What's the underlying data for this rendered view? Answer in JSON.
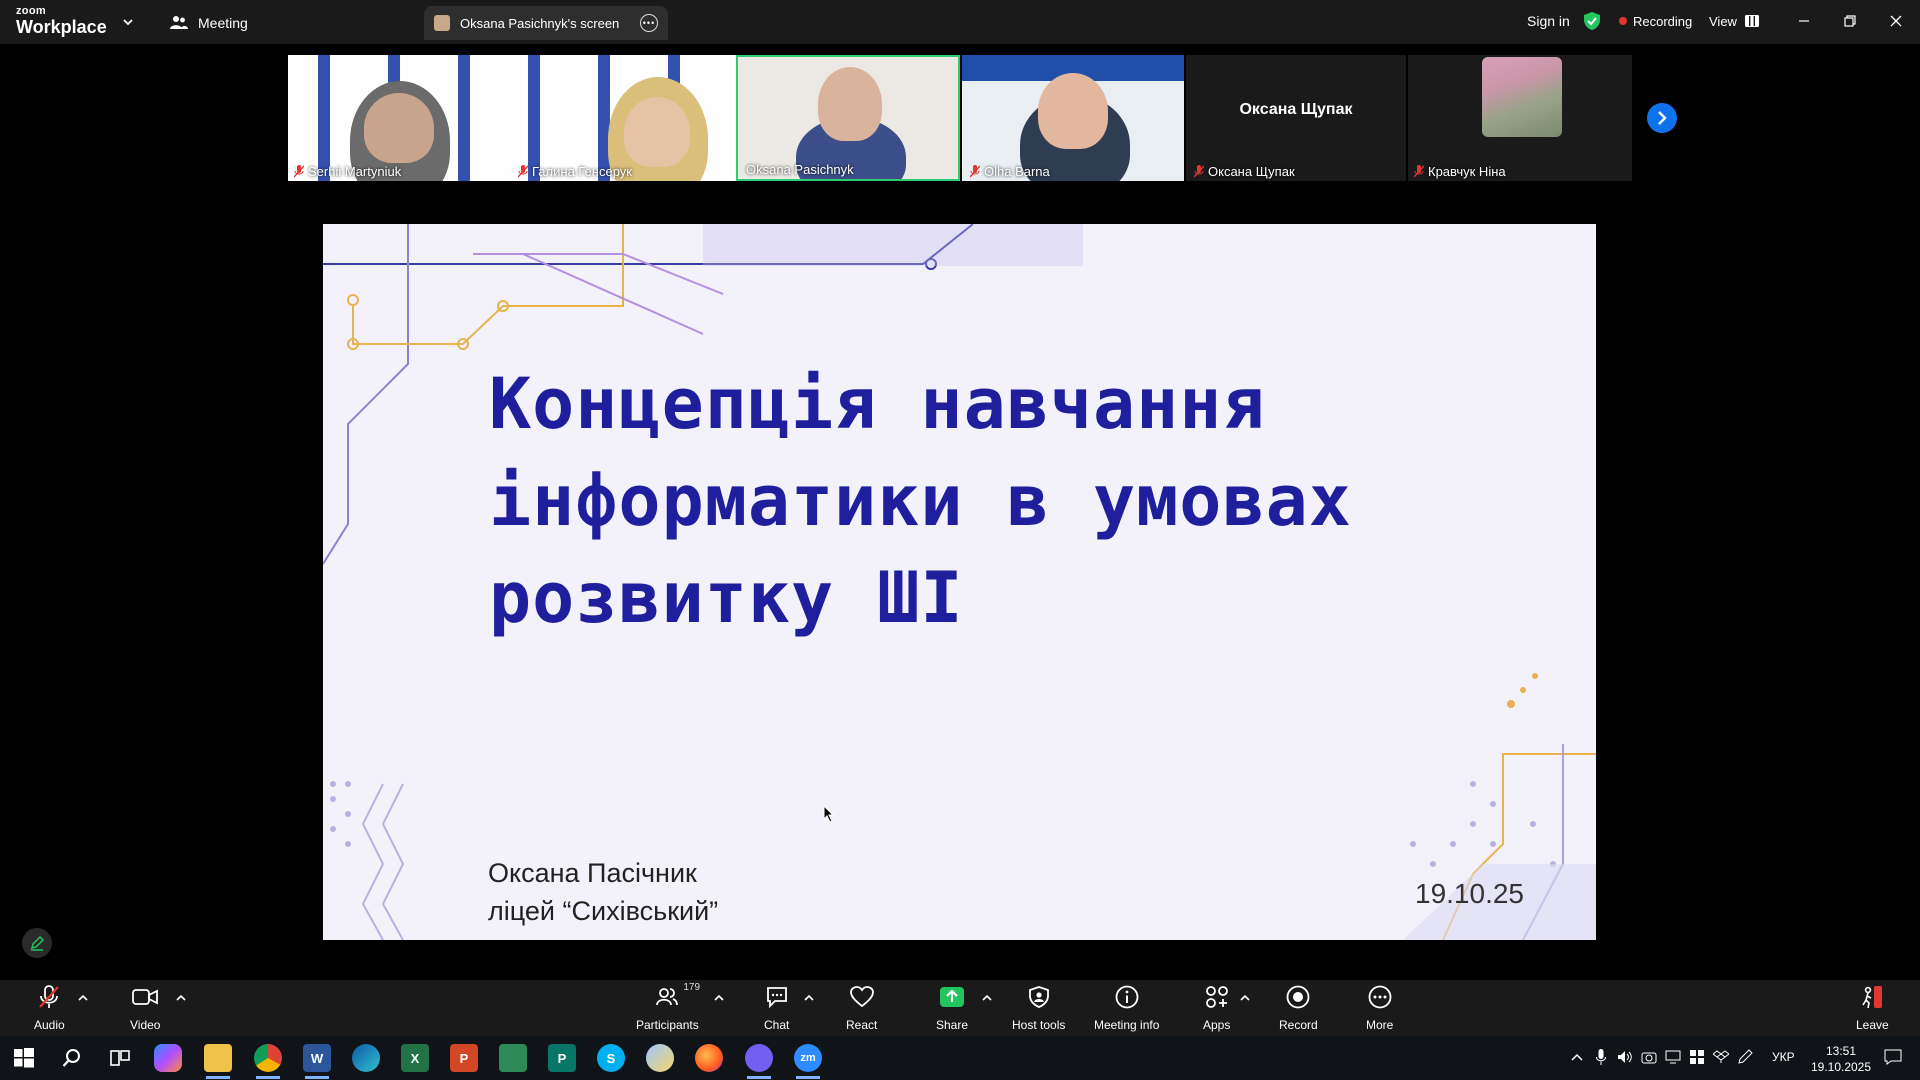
{
  "titlebar": {
    "logo_line1": "zoom",
    "logo_line2": "Workplace",
    "meeting_tab": "Meeting",
    "screen_tab": "Oksana Pasichnyk's screen",
    "sign_in": "Sign in",
    "recording": "Recording",
    "view": "View"
  },
  "participants": [
    {
      "name": "Serhii Martyniuk",
      "muted": true
    },
    {
      "name": "Галина Генсерук",
      "muted": true
    },
    {
      "name": "Oksana Pasichnyk",
      "muted": false,
      "active_speaker": true
    },
    {
      "name": "Olha Barna",
      "muted": true
    },
    {
      "name": "Оксана Щупак",
      "muted": true,
      "center_label": "Оксана Щупак"
    },
    {
      "name": "Кравчук Ніна",
      "muted": true
    }
  ],
  "slide": {
    "title_lines": [
      "Концепція навчання",
      "інформатики в умовах",
      "розвитку ШІ"
    ],
    "author": "Оксана Пасічник",
    "school": "ліцей “Сихівський”",
    "date": "19.10.25"
  },
  "toolbar": {
    "audio": "Audio",
    "video": "Video",
    "participants": "Participants",
    "participants_count": "179",
    "chat": "Chat",
    "react": "React",
    "share": "Share",
    "host_tools": "Host tools",
    "meeting_info": "Meeting info",
    "apps": "Apps",
    "record": "Record",
    "more": "More",
    "leave": "Leave"
  },
  "taskbar": {
    "apps": [
      "start-icon",
      "search-icon",
      "task-view-icon",
      "copilot-icon",
      "file-explorer-icon",
      "chrome-icon",
      "word-icon",
      "edge-icon",
      "excel-icon",
      "powerpoint-icon",
      "access-icon",
      "publisher-icon",
      "skype-icon",
      "paint-icon",
      "firefox-icon",
      "viber-icon",
      "zoom-icon"
    ],
    "language": "УКР",
    "time": "13:51",
    "date": "19.10.2025"
  },
  "colors": {
    "accent_blue": "#0e72ed",
    "recording_red": "#e0372f",
    "share_green": "#22c55e",
    "active_speaker_border": "#2ecc71",
    "slide_title": "#1f1f9e"
  }
}
